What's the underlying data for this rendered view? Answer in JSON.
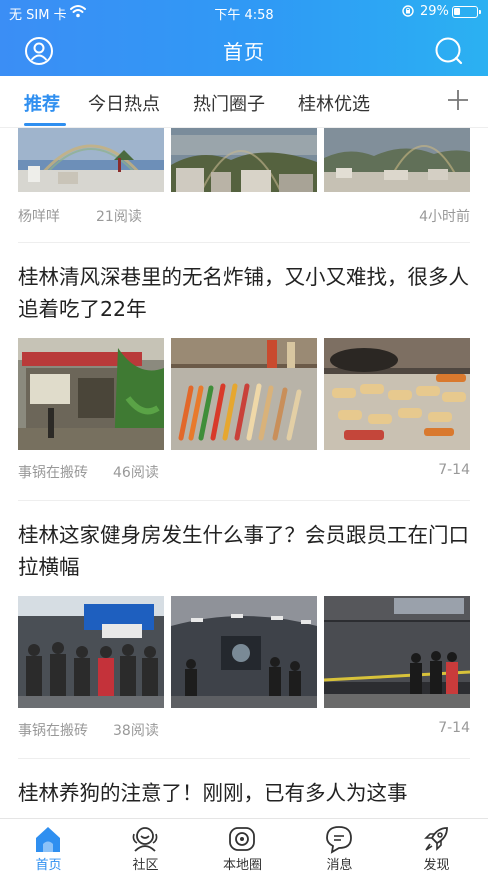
{
  "status_bar": {
    "carrier": "无 SIM 卡",
    "time": "下午 4:58",
    "battery": "29%",
    "battery_level": 0.29
  },
  "header": {
    "title": "首页",
    "left_icon": "user-icon",
    "right_icon": "search-icon"
  },
  "tabs": [
    {
      "label": "推荐",
      "active": true
    },
    {
      "label": "今日热点",
      "active": false
    },
    {
      "label": "热门圈子",
      "active": false
    },
    {
      "label": "桂林优选",
      "active": false
    }
  ],
  "tabs_add_icon": "plus-icon",
  "articles": [
    {
      "headline": "",
      "author": "杨咩咩",
      "reads": "21阅读",
      "time": "4小时前",
      "images": [
        "rainbow-photo",
        "rainbow-city-photo",
        "rainbow-hills-photo"
      ]
    },
    {
      "headline": "桂林清风深巷里的无名炸铺，又小又难找，很多人追着吃了22年",
      "author": "事锅在搬砖",
      "reads": "46阅读",
      "time": "7-14",
      "images": [
        "alley-shop-photo",
        "skewers-photo",
        "fried-skewers-photo"
      ]
    },
    {
      "headline": "桂林这家健身房发生什么事了？会员跟员工在门口拉横幅",
      "author": "事锅在搬砖",
      "reads": "38阅读",
      "time": "7-14",
      "images": [
        "gym-crowd-photo",
        "gym-interior-photo",
        "gym-entrance-photo"
      ]
    },
    {
      "headline": "桂林养狗的注意了！刚刚，已有多人为这事"
    }
  ],
  "bottom_nav": [
    {
      "label": "首页",
      "icon": "home-icon",
      "active": true
    },
    {
      "label": "社区",
      "icon": "community-icon",
      "active": false
    },
    {
      "label": "本地圈",
      "icon": "local-circle-icon",
      "active": false
    },
    {
      "label": "消息",
      "icon": "message-icon",
      "active": false
    },
    {
      "label": "发现",
      "icon": "rocket-icon",
      "active": false
    }
  ],
  "colors": {
    "accent": "#2f8ff0",
    "header_gradient_start": "#3b8ef5",
    "header_gradient_end": "#2bb1f2",
    "meta_text": "#999999"
  }
}
